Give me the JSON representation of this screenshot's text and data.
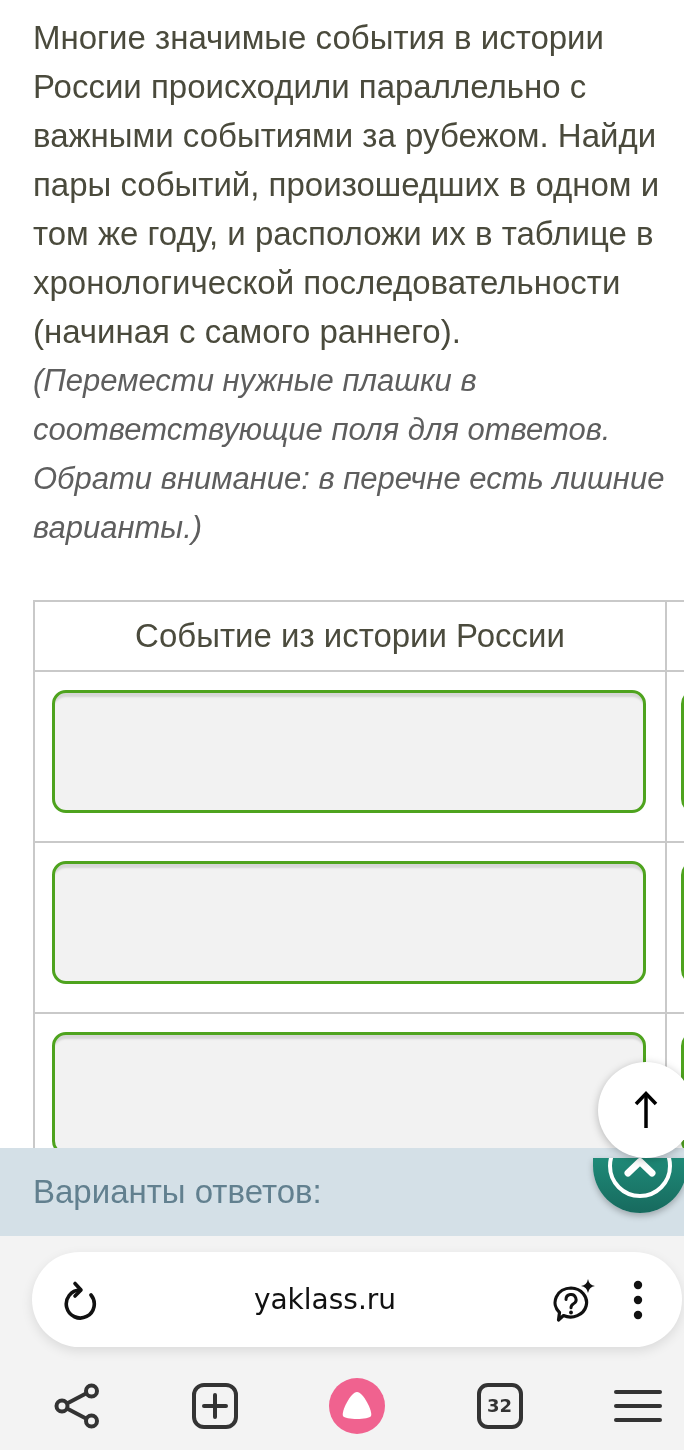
{
  "question": {
    "text": "Многие значимые события в истории России происходили параллельно с важными событиями за рубежом. Найди пары событий, произошедших в одном и том же году, и расположи их в таблице в хронологической последовательности (начиная с самого раннего).",
    "hint": "(Перемести нужные плашки в соответствующие поля для ответов. Обрати внимание: в перечне есть лишние варианты.)"
  },
  "table": {
    "columns": [
      "Событие из истории России"
    ],
    "rows": [
      {
        "cells": [
          {
            "kind": "drop-field"
          },
          {
            "kind": "drop-field"
          }
        ]
      },
      {
        "cells": [
          {
            "kind": "drop-field"
          },
          {
            "kind": "drop-field"
          }
        ]
      },
      {
        "cells": [
          {
            "kind": "drop-field"
          },
          {
            "kind": "drop-field"
          }
        ]
      }
    ]
  },
  "answer_options": {
    "title": "Варианты ответов:"
  },
  "browser": {
    "url": "yaklass.ru",
    "tab_count": "32"
  }
}
